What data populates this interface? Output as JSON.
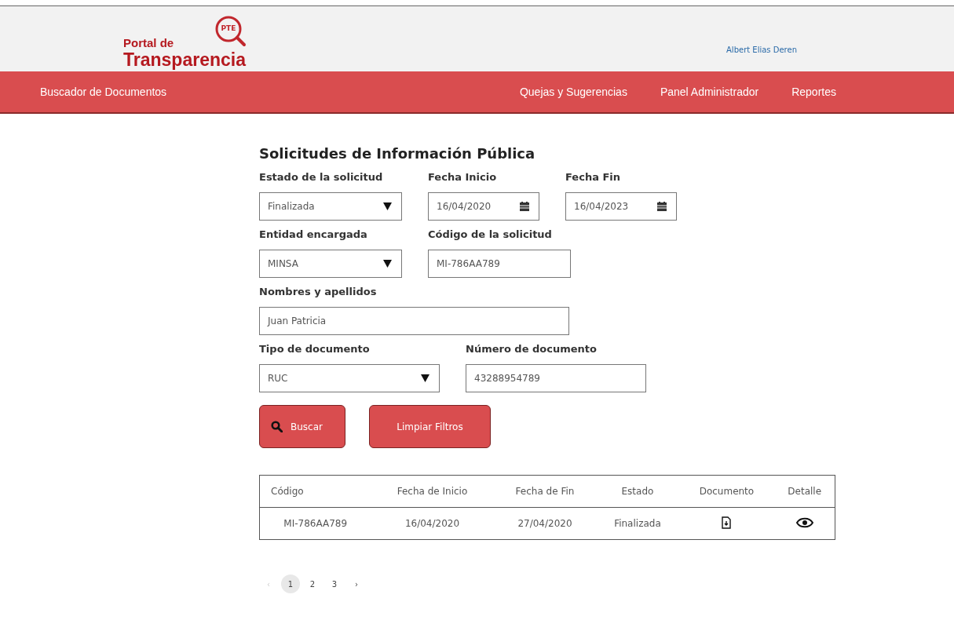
{
  "header": {
    "logo": {
      "badge": "PTE",
      "line_1": "Portal de",
      "line_2": "Transparencia"
    },
    "user": "Albert Elias Deren"
  },
  "nav": [
    {
      "label": "Buscador de Documentos"
    },
    {
      "label": "Quejas y Sugerencias"
    },
    {
      "label": "Panel Administrador"
    },
    {
      "label": "Reportes"
    }
  ],
  "title": "Solicitudes de Información Pública",
  "filter_rows": [
    [
      {
        "kind": "select",
        "label": "Estado de la solicitud",
        "value": "Finalizada"
      },
      {
        "kind": "date",
        "label": "Fecha Inicio",
        "value": "16/04/2020"
      },
      {
        "kind": "date",
        "label": "Fecha Fin",
        "value": "16/04/2023"
      }
    ],
    [
      {
        "kind": "select",
        "label": "Entidad encargada",
        "value": "MINSA"
      },
      {
        "kind": "text",
        "label": "Código de la solicitud",
        "value": "MI-786AA789"
      }
    ],
    [
      {
        "kind": "text",
        "label": "Nombres y apellidos",
        "value": "Juan Patricia"
      }
    ],
    [
      {
        "kind": "select",
        "label": "Tipo de documento",
        "value": "RUC"
      },
      {
        "kind": "text",
        "label": "Número de documento",
        "value": "43288954789"
      }
    ]
  ],
  "buttons": [
    {
      "label": "Buscar"
    },
    {
      "label": "Limpiar Filtros"
    }
  ],
  "table": {
    "columns": [
      "Código",
      "Fecha de Inicio",
      "Fecha de Fin",
      "Estado",
      "Documento",
      "Detalle"
    ],
    "rows": [
      {
        "codigo": "MI-786AA789",
        "fecha_inicio": "16/04/2020",
        "fecha_fin": "27/04/2020",
        "estado": "Finalizada"
      }
    ]
  },
  "pagination": {
    "prev": {
      "label": "‹",
      "disabled": true
    },
    "pages": [
      {
        "label": "1",
        "selected": true
      },
      {
        "label": "2",
        "selected": false
      },
      {
        "label": "3",
        "selected": false
      }
    ],
    "next": {
      "label": "›",
      "disabled": false
    }
  }
}
